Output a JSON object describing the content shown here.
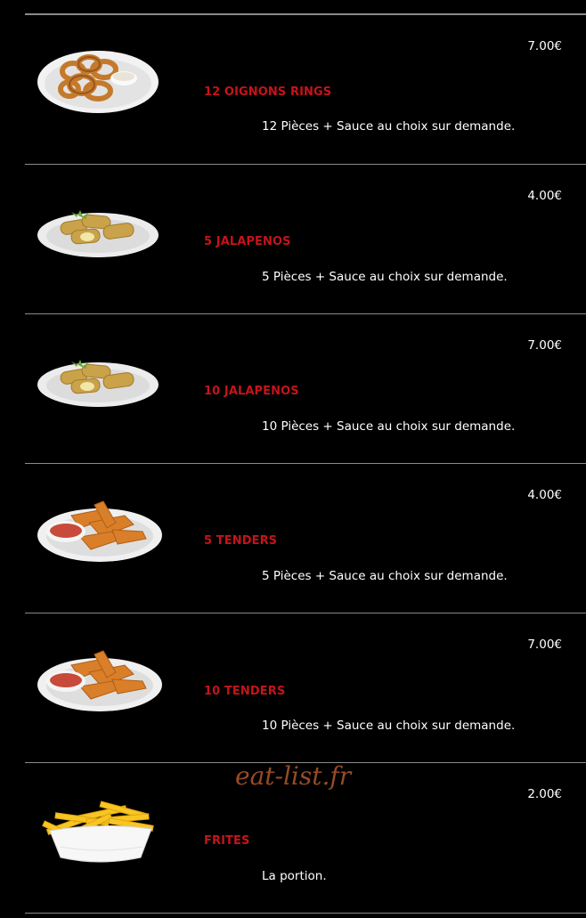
{
  "items": [
    {
      "name": "12 OIGNONS RINGS",
      "desc": "12 Pièces + Sauce au choix sur demande.",
      "price": "7.00€",
      "image": "onion-rings-plate"
    },
    {
      "name": "5 JALAPENOS",
      "desc": "5 Pièces + Sauce au choix sur demande.",
      "price": "4.00€",
      "image": "jalapenos-plate"
    },
    {
      "name": "10 JALAPENOS",
      "desc": "10 Pièces + Sauce au choix sur demande.",
      "price": "7.00€",
      "image": "jalapenos-plate"
    },
    {
      "name": "5 TENDERS",
      "desc": "5 Pièces + Sauce au choix sur demande.",
      "price": "4.00€",
      "image": "tenders-plate"
    },
    {
      "name": "10 TENDERS",
      "desc": "10 Pièces + Sauce au choix sur demande.",
      "price": "7.00€",
      "image": "tenders-plate"
    },
    {
      "name": "FRITES",
      "desc": "La portion.",
      "price": "2.00€",
      "image": "fries-bowl"
    }
  ],
  "watermark": "eat-list.fr",
  "colors": {
    "background": "#000000",
    "name": "#c4141a",
    "divider": "#8a8a8a",
    "watermark": "#a8542a"
  }
}
